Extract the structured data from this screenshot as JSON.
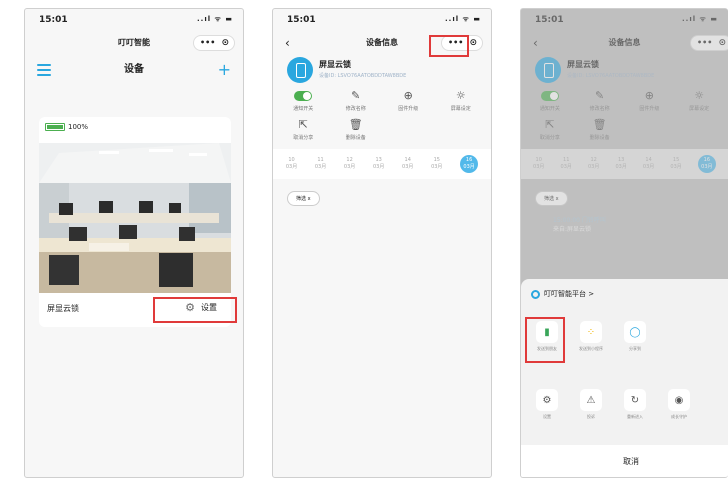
{
  "status": {
    "time": "15:01",
    "icons": "..ıl ᯤ ▬"
  },
  "capsule": {
    "dots": "•••",
    "target": "⊙"
  },
  "phone1": {
    "nav_title": "叮叮智能",
    "page_title": "设备",
    "plus": "+",
    "battery_pct": "100%",
    "battery_level": 1.0,
    "device_name": "屏显云锁",
    "settings_label": "设置",
    "gear_glyph": "⚙"
  },
  "phone2": {
    "back": "‹",
    "nav_title": "设备信息",
    "device_name": "屏显云锁",
    "device_id": "设备ID: LSVO76AATOBDDTAW8BDE",
    "actions": [
      {
        "icon": "toggle",
        "label": "通知开关"
      },
      {
        "icon": "✎",
        "label": "修改名称"
      },
      {
        "icon": "⊕",
        "label": "固件升级"
      },
      {
        "icon": "☼",
        "label": "屏幕设定"
      },
      {
        "icon": "⇱",
        "label": "取消分享"
      },
      {
        "icon": "🗑",
        "label": "删除设备"
      }
    ],
    "dates": [
      {
        "day": "10",
        "month": "03月"
      },
      {
        "day": "11",
        "month": "03月"
      },
      {
        "day": "12",
        "month": "03月"
      },
      {
        "day": "13",
        "month": "03月"
      },
      {
        "day": "14",
        "month": "03月"
      },
      {
        "day": "15",
        "month": "03月"
      },
      {
        "day": "16",
        "month": "03月"
      }
    ],
    "filter": "筛选  x"
  },
  "phone3": {
    "event_time": "15:00:00 门铃呼叫",
    "event_src": "来自:屏显云锁",
    "sheet_title": "叮叮智能平台 >",
    "row1": [
      {
        "icon": "▮",
        "label": "发送到朋友",
        "color": "#3aa65a"
      },
      {
        "icon": "⁘",
        "label": "发送到小程序",
        "color": "#f0b400"
      },
      {
        "icon": "◯",
        "label": "分享到",
        "color": "#2aa7df"
      }
    ],
    "row2": [
      {
        "icon": "⚙",
        "label": "设置"
      },
      {
        "icon": "⚠",
        "label": "投诉"
      },
      {
        "icon": "↻",
        "label": "重新进入"
      },
      {
        "icon": "◉",
        "label": "成长守护"
      }
    ],
    "cancel": "取消"
  },
  "colors": {
    "accent": "#2aa7df",
    "highlight": "#e03a3a",
    "battery": "#4caf50"
  }
}
